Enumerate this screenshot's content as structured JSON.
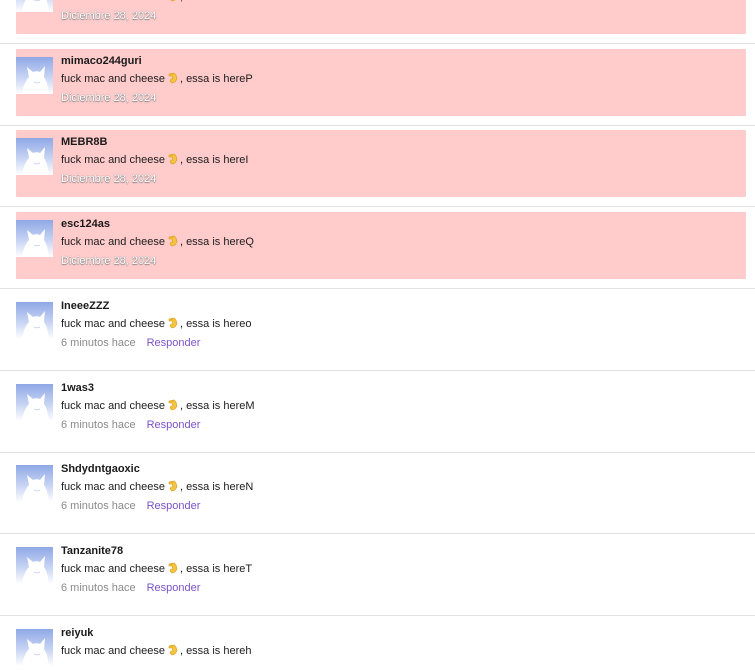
{
  "comments": [
    {
      "username": "",
      "text": "fuck mac and cheese",
      "text_suffix": ", essa is hereD",
      "date": "Diciembre 28, 2024",
      "flagged": true,
      "reply_label": ""
    },
    {
      "username": "mimaco244guri",
      "text": "fuck mac and cheese",
      "text_suffix": ", essa is hereP",
      "date": "Diciembre 28, 2024",
      "flagged": true,
      "reply_label": ""
    },
    {
      "username": "MEBR8B",
      "text": "fuck mac and cheese",
      "text_suffix": ", essa is hereI",
      "date": "Diciembre 28, 2024",
      "flagged": true,
      "reply_label": ""
    },
    {
      "username": "esc124as",
      "text": "fuck mac and cheese",
      "text_suffix": ", essa is hereQ",
      "date": "Diciembre 28, 2024",
      "flagged": true,
      "reply_label": ""
    },
    {
      "username": "IneeeZZZ",
      "text": "fuck mac and cheese",
      "text_suffix": ", essa is hereo",
      "date": "6 minutos hace",
      "flagged": false,
      "reply_label": "Responder"
    },
    {
      "username": "1was3",
      "text": "fuck mac and cheese",
      "text_suffix": ", essa is hereM",
      "date": "6 minutos hace",
      "flagged": false,
      "reply_label": "Responder"
    },
    {
      "username": "Shdydntgaoxic",
      "text": "fuck mac and cheese",
      "text_suffix": ", essa is hereN",
      "date": "6 minutos hace",
      "flagged": false,
      "reply_label": "Responder"
    },
    {
      "username": "Tanzanite78",
      "text": "fuck mac and cheese",
      "text_suffix": ", essa is hereT",
      "date": "6 minutos hace",
      "flagged": false,
      "reply_label": "Responder"
    },
    {
      "username": "reiyuk",
      "text": "fuck mac and cheese",
      "text_suffix": ", essa is hereh",
      "date": "",
      "flagged": false,
      "reply_label": ""
    }
  ],
  "icons": {
    "avatar": "default-cat-avatar-icon",
    "emoji": "pinching-hand-emoji-icon"
  },
  "colors": {
    "flagged_background": "#ffcbcb",
    "reply_link": "#7b52c8",
    "avatar_top": "#8fa8e6",
    "avatar_bottom": "#ffffff",
    "divider": "#e2e2e2"
  }
}
